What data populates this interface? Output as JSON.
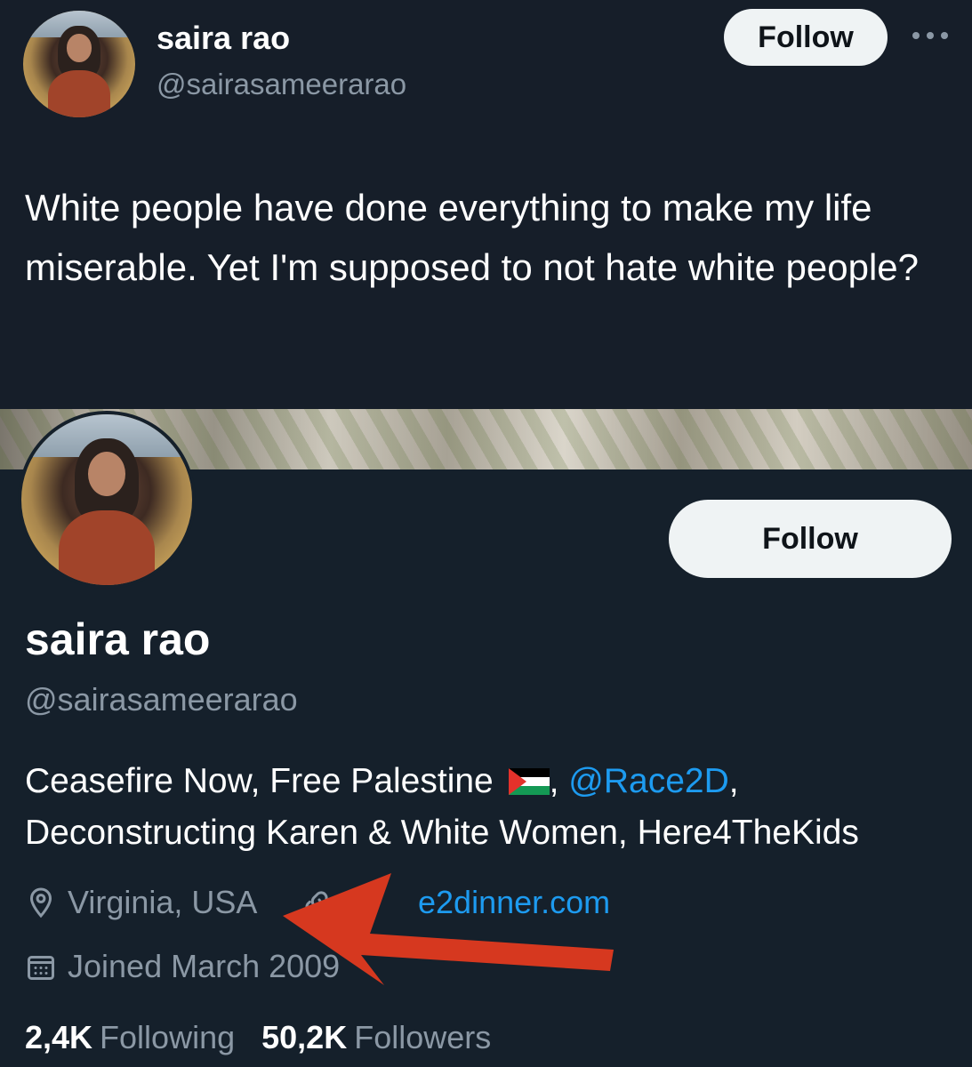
{
  "tweet": {
    "author_name": "saira rao",
    "author_handle": "@sairasameerarao",
    "follow_label": "Follow",
    "more_icon": "more-horizontal-icon",
    "text": "White people have done everything to make my life miserable. Yet I'm supposed to not hate white people?"
  },
  "profile": {
    "follow_label": "Follow",
    "name": "saira rao",
    "handle": "@sairasameerarao",
    "bio_part1": "Ceasefire Now, Free Palestine ",
    "bio_sep": ", ",
    "bio_mention": "@Race2D",
    "bio_part2": ",",
    "bio_line2": "Deconstructing Karen & White Women, Here4TheKids",
    "location": "Virginia, USA",
    "website": "e2dinner.com",
    "joined": "Joined March 2009",
    "following_count": "2,4K",
    "following_label": "Following",
    "followers_count": "50,2K",
    "followers_label": "Followers"
  },
  "colors": {
    "background": "#15202b",
    "link": "#1d9bf0",
    "muted": "#8b98a5",
    "annotation_arrow": "#d6381f"
  }
}
